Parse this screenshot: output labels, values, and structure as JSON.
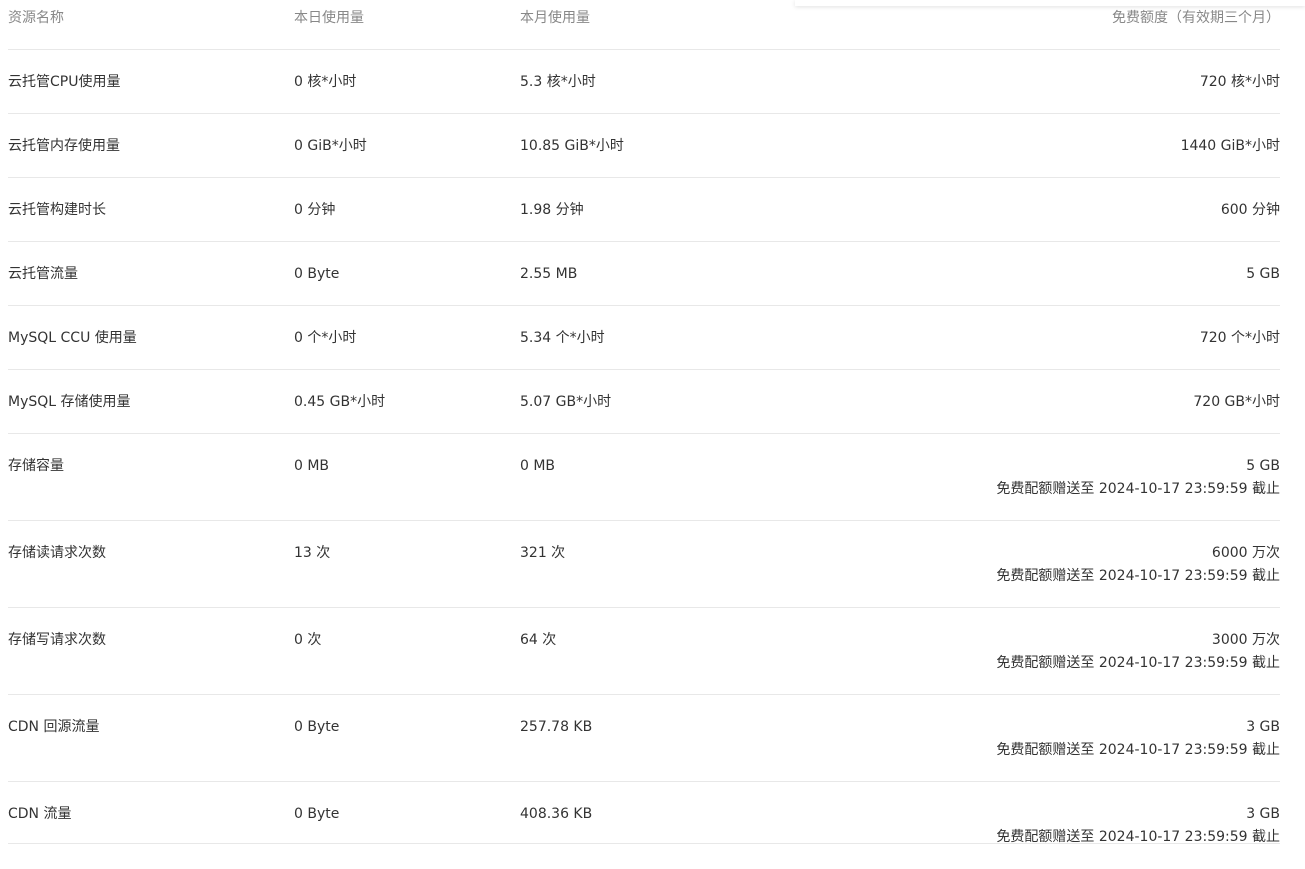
{
  "table": {
    "headers": {
      "name": "资源名称",
      "day": "本日使用量",
      "month": "本月使用量",
      "free": "免费额度（有效期三个月）"
    },
    "rows": [
      {
        "name": "云托管CPU使用量",
        "day": "0 核*小时",
        "month": "5.3 核*小时",
        "free": "720 核*小时",
        "note": ""
      },
      {
        "name": "云托管内存使用量",
        "day": "0 GiB*小时",
        "month": "10.85 GiB*小时",
        "free": "1440 GiB*小时",
        "note": ""
      },
      {
        "name": "云托管构建时长",
        "day": "0 分钟",
        "month": "1.98 分钟",
        "free": "600 分钟",
        "note": ""
      },
      {
        "name": "云托管流量",
        "day": "0 Byte",
        "month": "2.55 MB",
        "free": "5 GB",
        "note": ""
      },
      {
        "name": "MySQL CCU 使用量",
        "day": "0 个*小时",
        "month": "5.34 个*小时",
        "free": "720 个*小时",
        "note": ""
      },
      {
        "name": "MySQL 存储使用量",
        "day": "0.45 GB*小时",
        "month": "5.07 GB*小时",
        "free": "720 GB*小时",
        "note": ""
      },
      {
        "name": "存储容量",
        "day": "0 MB",
        "month": "0 MB",
        "free": "5 GB",
        "note": "免费配额赠送至 2024-10-17 23:59:59 截止"
      },
      {
        "name": "存储读请求次数",
        "day": "13 次",
        "month": "321 次",
        "free": "6000 万次",
        "note": "免费配额赠送至 2024-10-17 23:59:59 截止"
      },
      {
        "name": "存储写请求次数",
        "day": "0 次",
        "month": "64 次",
        "free": "3000 万次",
        "note": "免费配额赠送至 2024-10-17 23:59:59 截止"
      },
      {
        "name": "CDN 回源流量",
        "day": "0 Byte",
        "month": "257.78 KB",
        "free": "3 GB",
        "note": "免费配额赠送至 2024-10-17 23:59:59 截止"
      },
      {
        "name": "CDN 流量",
        "day": "0 Byte",
        "month": "408.36 KB",
        "free": "3 GB",
        "note": "免费配额赠送至 2024-10-17 23:59:59 截止"
      }
    ]
  }
}
